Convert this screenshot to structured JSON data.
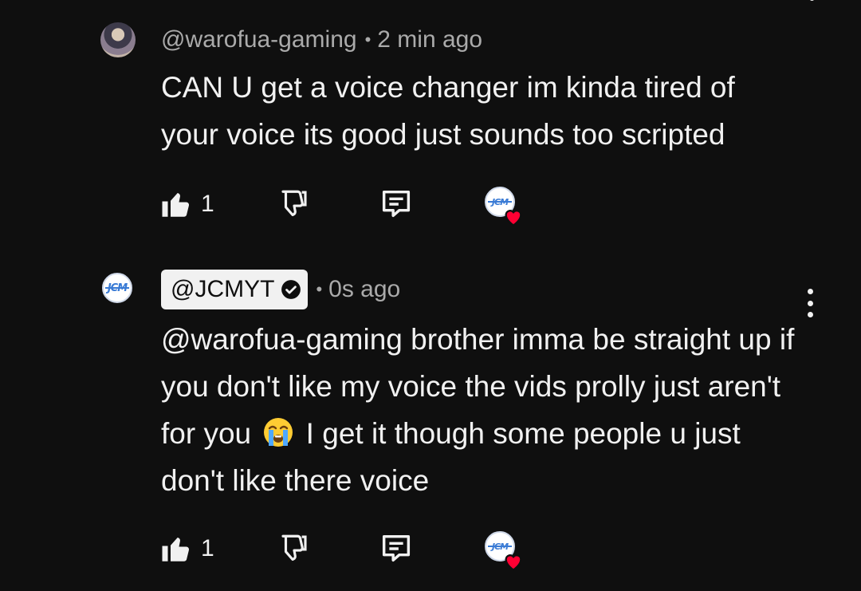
{
  "comments": [
    {
      "author": "@warofua-gaming",
      "time": "2 min ago",
      "text": "CAN U get a voice changer im kinda tired of your voice its good just sounds too scripted",
      "likes": "1",
      "avatar_icon": "user-avatar-icon",
      "creator_heart": true
    },
    {
      "author": "@JCMYT",
      "verified": true,
      "time": "0s ago",
      "mention": "@warofua-gaming",
      "text_part1": " brother imma be straight up if you don't like my voice the vids prolly just aren't for you ",
      "emoji": "loudly-crying-face-icon",
      "text_part2": " I get it though some people u just don't like there voice",
      "likes": "1",
      "avatar_icon": "jcm-logo-icon",
      "creator_heart": true
    }
  ],
  "logo_text": "JCM",
  "colors": {
    "background": "#0f0f0f",
    "text": "#f1f1f1",
    "muted": "#aaaaaa",
    "heart": "#ff0033",
    "logo_blue": "#3a7bd5"
  },
  "icons": {
    "like": "thumbs-up-icon",
    "dislike": "thumbs-down-icon",
    "reply": "reply-icon",
    "more": "more-vert-icon",
    "verified": "verified-check-icon",
    "heart": "heart-icon"
  }
}
